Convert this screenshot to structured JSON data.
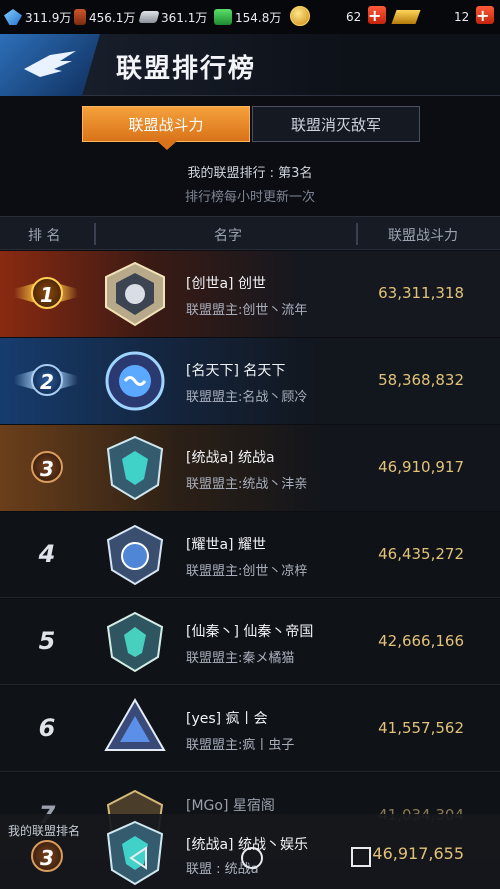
{
  "resources": {
    "crystal": "311.9万",
    "oil": "456.1万",
    "steel": "361.1万",
    "cash": "154.8万",
    "coin": "62",
    "gold": "12"
  },
  "header": {
    "title": "联盟排行榜"
  },
  "tabs": [
    {
      "label": "联盟战斗力",
      "active": true
    },
    {
      "label": "联盟消灭敌军",
      "active": false
    }
  ],
  "my_rank_text": "我的联盟排行 : 第3名",
  "update_note": "排行榜每小时更新一次",
  "columns": {
    "rank": "排 名",
    "name": "名字",
    "power": "联盟战斗力"
  },
  "rows": [
    {
      "rank": "1",
      "name": "[创世a] 创世",
      "leader": "联盟盟主:创世丶流年",
      "power": "63,311,318"
    },
    {
      "rank": "2",
      "name": "[名天下] 名天下",
      "leader": "联盟盟主:名战丶顾冷",
      "power": "58,368,832"
    },
    {
      "rank": "3",
      "name": "[统战a] 统战a",
      "leader": "联盟盟主:统战丶沣亲",
      "power": "46,910,917"
    },
    {
      "rank": "4",
      "name": "[耀世a] 耀世",
      "leader": "联盟盟主:创世丶凉梓",
      "power": "46,435,272"
    },
    {
      "rank": "5",
      "name": "[仙秦丶] 仙秦丶帝国",
      "leader": "联盟盟主:秦メ橘猫",
      "power": "42,666,166"
    },
    {
      "rank": "6",
      "name": "[yes] 疯丨会",
      "leader": "联盟盟主:疯丨虫子",
      "power": "41,557,562"
    },
    {
      "rank": "7",
      "name": "[MGo] 星宿阁",
      "leader": "",
      "power": "41,034,304"
    }
  ],
  "my_alliance": {
    "label": "我的联盟排名",
    "rank": "3",
    "name": "[统战a] 统战丶娱乐",
    "leader": "联盟 : 统战a",
    "power": "46,917,655"
  },
  "colors": {
    "accent": "#e8892a",
    "power_text": "#e2c27a"
  }
}
